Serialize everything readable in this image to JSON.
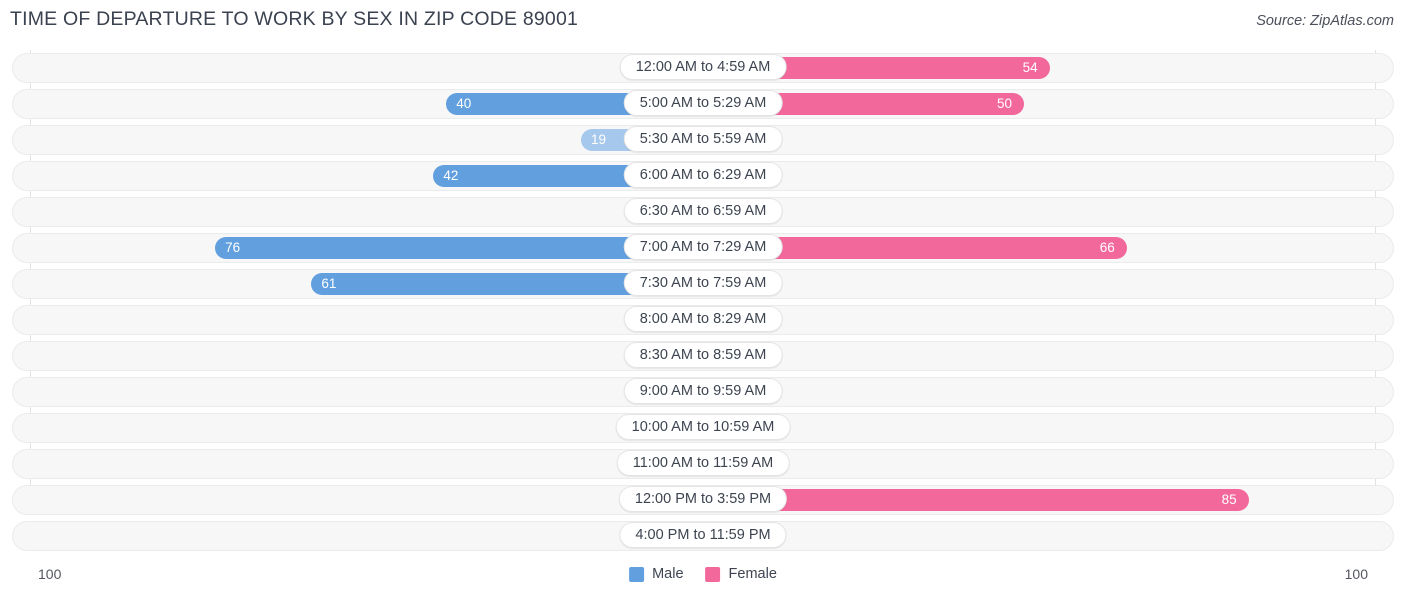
{
  "header": {
    "title": "TIME OF DEPARTURE TO WORK BY SEX IN ZIP CODE 89001",
    "source": "Source: ZipAtlas.com"
  },
  "legend": {
    "items": [
      {
        "label": "Male",
        "color": "#629fdf"
      },
      {
        "label": "Female",
        "color": "#f2689a"
      }
    ]
  },
  "axis": {
    "left_max": "100",
    "right_max": "100"
  },
  "colors": {
    "male_strong": "#629fdf",
    "male_light": "#a6c8ed",
    "female_strong": "#f2689a",
    "female_light": "#f9a8c3",
    "track": "#f7f7f7",
    "track_border": "#ebebeb",
    "gridline": "#e2e2e4"
  },
  "chart_data": {
    "type": "bar",
    "subtype": "diverging-bar",
    "title": "TIME OF DEPARTURE TO WORK BY SEX IN ZIP CODE 89001",
    "xlabel": "",
    "ylabel": "",
    "xlim": [
      100,
      100
    ],
    "grid": true,
    "legend_position": "bottom-center",
    "categories": [
      "12:00 AM to 4:59 AM",
      "5:00 AM to 5:29 AM",
      "5:30 AM to 5:59 AM",
      "6:00 AM to 6:29 AM",
      "6:30 AM to 6:59 AM",
      "7:00 AM to 7:29 AM",
      "7:30 AM to 7:59 AM",
      "8:00 AM to 8:29 AM",
      "8:30 AM to 8:59 AM",
      "9:00 AM to 9:59 AM",
      "10:00 AM to 10:59 AM",
      "11:00 AM to 11:59 AM",
      "12:00 PM to 3:59 PM",
      "4:00 PM to 11:59 PM"
    ],
    "series": [
      {
        "name": "Male",
        "values": [
          0,
          40,
          19,
          42,
          1,
          76,
          61,
          0,
          0,
          0,
          0,
          0,
          0,
          0
        ]
      },
      {
        "name": "Female",
        "values": [
          54,
          50,
          0,
          0,
          0,
          66,
          0,
          9,
          0,
          0,
          0,
          0,
          85,
          0
        ]
      }
    ]
  },
  "rows": [
    {
      "category": "12:00 AM to 4:59 AM",
      "male": "0",
      "female": "54"
    },
    {
      "category": "5:00 AM to 5:29 AM",
      "male": "40",
      "female": "50"
    },
    {
      "category": "5:30 AM to 5:59 AM",
      "male": "19",
      "female": "0"
    },
    {
      "category": "6:00 AM to 6:29 AM",
      "male": "42",
      "female": "0"
    },
    {
      "category": "6:30 AM to 6:59 AM",
      "male": "1",
      "female": "0"
    },
    {
      "category": "7:00 AM to 7:29 AM",
      "male": "76",
      "female": "66"
    },
    {
      "category": "7:30 AM to 7:59 AM",
      "male": "61",
      "female": "0"
    },
    {
      "category": "8:00 AM to 8:29 AM",
      "male": "0",
      "female": "9"
    },
    {
      "category": "8:30 AM to 8:59 AM",
      "male": "0",
      "female": "0"
    },
    {
      "category": "9:00 AM to 9:59 AM",
      "male": "0",
      "female": "0"
    },
    {
      "category": "10:00 AM to 10:59 AM",
      "male": "0",
      "female": "0"
    },
    {
      "category": "11:00 AM to 11:59 AM",
      "male": "0",
      "female": "0"
    },
    {
      "category": "12:00 PM to 3:59 PM",
      "male": "0",
      "female": "85"
    },
    {
      "category": "4:00 PM to 11:59 PM",
      "male": "0",
      "female": "0"
    }
  ]
}
